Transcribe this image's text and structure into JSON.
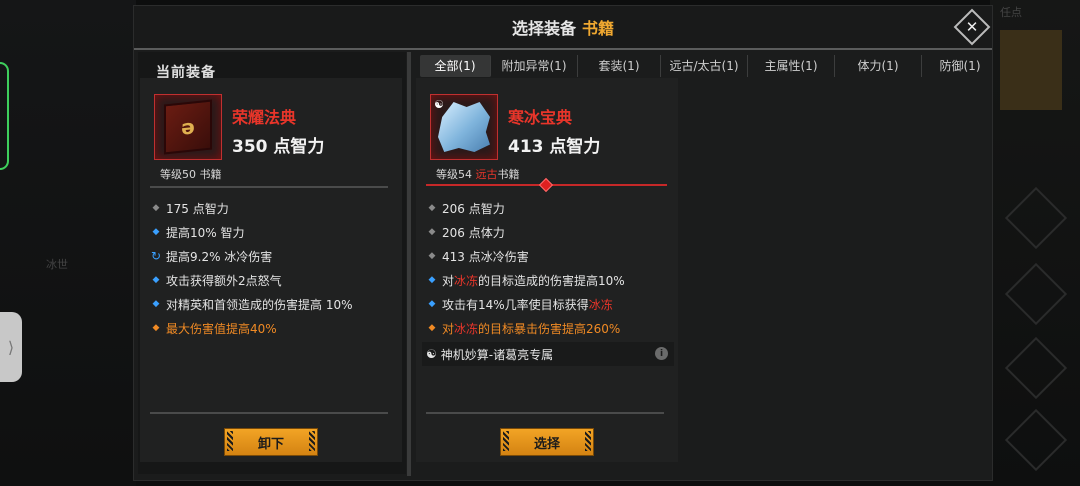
{
  "title": {
    "prefix": "选择装备",
    "category": "书籍"
  },
  "current": {
    "section_title": "当前装备",
    "name": "荣耀法典",
    "main_stat": "350 点智力",
    "level_text": "等级50 书籍",
    "attributes": [
      {
        "bullet": "grey",
        "text": "175 点智力"
      },
      {
        "bullet": "blue",
        "text": "提高10% 智力"
      },
      {
        "bullet": "cycle",
        "text": "提高9.2% 冰冷伤害"
      },
      {
        "bullet": "blue",
        "text": "攻击获得额外2点怒气"
      },
      {
        "bullet": "blue",
        "text": "对精英和首领造成的伤害提高 10%"
      },
      {
        "bullet": "orange",
        "text": "最大伤害值提高40%"
      }
    ],
    "button": "卸下"
  },
  "tabs": [
    {
      "label": "全部(1)",
      "active": true
    },
    {
      "label": "附加异常(1)",
      "active": false
    },
    {
      "label": "套装(1)",
      "active": false
    },
    {
      "label": "远古/太古(1)",
      "active": false
    },
    {
      "label": "主属性(1)",
      "active": false
    },
    {
      "label": "体力(1)",
      "active": false
    },
    {
      "label": "防御(1)",
      "active": false
    }
  ],
  "candidate": {
    "name": "寒冰宝典",
    "main_stat": "413 点智力",
    "level_prefix": "等级54",
    "rarity": "远古",
    "type": "书籍",
    "attributes": [
      {
        "bullet": "grey",
        "parts": [
          {
            "t": "206 点智力"
          }
        ]
      },
      {
        "bullet": "grey",
        "parts": [
          {
            "t": "206 点体力"
          }
        ]
      },
      {
        "bullet": "grey",
        "parts": [
          {
            "t": "413 点冰冷伤害"
          }
        ]
      },
      {
        "bullet": "blue",
        "parts": [
          {
            "t": "对"
          },
          {
            "t": "冰冻",
            "red": true
          },
          {
            "t": "的目标造成的伤害提高10%"
          }
        ]
      },
      {
        "bullet": "blue",
        "parts": [
          {
            "t": "攻击有14%几率使目标获得"
          },
          {
            "t": "冰冻",
            "red": true
          }
        ]
      },
      {
        "bullet": "orange",
        "parts": [
          {
            "t": "对"
          },
          {
            "t": "冰冻",
            "red": true
          },
          {
            "t": "的目标暴击伤害提高260%"
          }
        ]
      }
    ],
    "special": "神机妙算-诸葛亮专属",
    "button": "选择"
  },
  "background": {
    "label_left": "冰世",
    "label_right": "任点"
  },
  "colors": {
    "accent": "#f0a830",
    "legendary_red": "#e8352a",
    "button": "#f2a425",
    "blue_bullet": "#3aa0ff",
    "orange_attr": "#f08a24"
  },
  "icons": [
    "close-icon",
    "book-icon",
    "ice-book-icon",
    "yin-yang-icon",
    "info-icon",
    "diamond-bullet-icon",
    "cycle-icon"
  ]
}
